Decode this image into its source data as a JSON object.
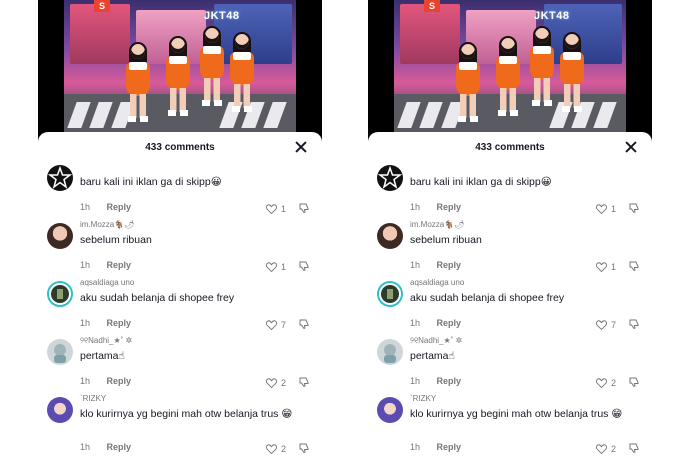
{
  "sheet": {
    "title": "433 comments"
  },
  "comments": [
    {
      "user": "",
      "text": "baru kali ini iklan ga di skipp😀",
      "time": "1h",
      "reply": "Reply",
      "likes": "1",
      "avatar": "star-avatar"
    },
    {
      "user": "im.Mozza🐐🌶",
      "text": "sebelum ribuan",
      "time": "1h",
      "reply": "Reply",
      "likes": "1",
      "avatar": "girl-avatar"
    },
    {
      "user": "aqsaldiaga uno",
      "text": "aku sudah belanja di shopee frey",
      "time": "1h",
      "reply": "Reply",
      "likes": "7",
      "avatar": "teal-ring-avatar"
    },
    {
      "user": "୨୧Nadhi_★˚ ✲",
      "text": "pertama☝",
      "time": "1h",
      "reply": "Reply",
      "likes": "2",
      "avatar": "gray-avatar"
    },
    {
      "user": "`RIZKY",
      "text": "klo kurirnya yg begini mah otw belanja trus 😁",
      "time": "1h",
      "reply": "Reply",
      "likes": "2",
      "avatar": "blue-avatar"
    }
  ],
  "video": {
    "sign": "S",
    "brand": "JKT48"
  },
  "colors": {
    "text": "#161823",
    "muted": "#75767b",
    "costume": "#f06a1c",
    "ring": "#32c0c8"
  }
}
